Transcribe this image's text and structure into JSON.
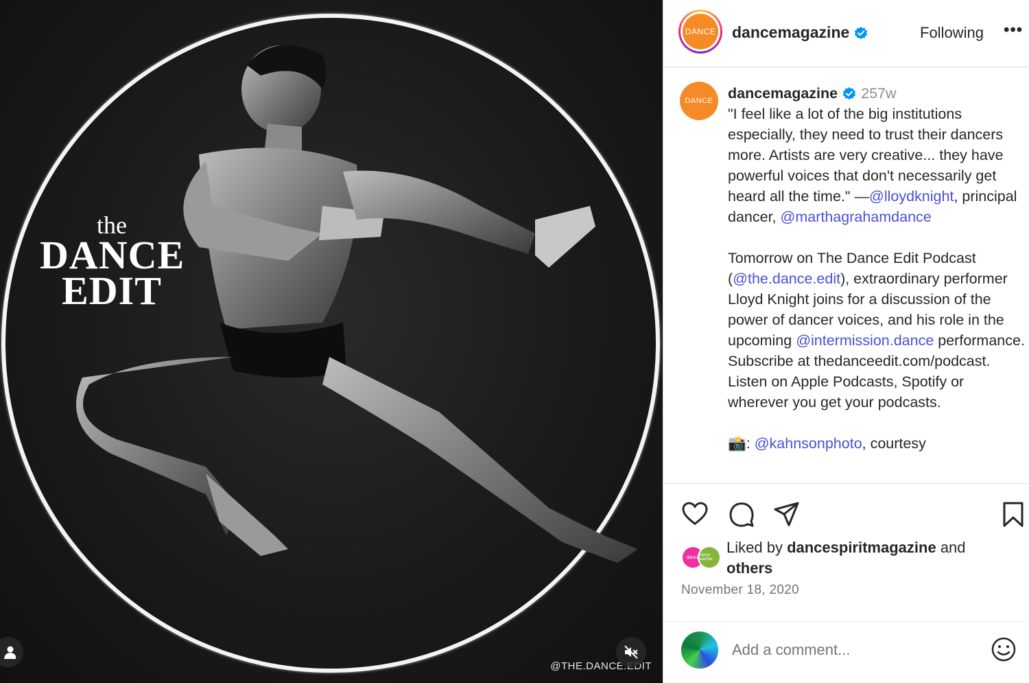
{
  "media": {
    "brand_the": "the",
    "brand_dance": "DANCE",
    "brand_edit": "EDIT",
    "watermark": "@THE.DANCE.EDIT"
  },
  "header": {
    "avatar_text": "DANCE",
    "username": "dancemagazine",
    "following_label": "Following",
    "more_label": "•••"
  },
  "caption": {
    "avatar_text": "DANCE",
    "username": "dancemagazine",
    "age": "257w",
    "quote": "\"I feel like a lot of the big institutions especially, they need to trust their dancers more. Artists are very creative... they have powerful voices that don't necessarily get heard all the time.\"",
    "dash": "—",
    "mention_1": "@lloydknight",
    "role_text": ", principal dancer,",
    "mention_2": "@marthagrahamdance",
    "para2_a": "Tomorrow on The Dance Edit Podcast (",
    "mention_3": "@the.dance.edit",
    "para2_b": "), extraordinary performer Lloyd Knight joins for a discussion of the power of dancer voices, and his role in the upcoming ",
    "mention_4": "@intermission.dance",
    "para2_c": " performance. Subscribe at thedanceedit.com/podcast. Listen on Apple Podcasts, Spotify or wherever you get your podcasts.",
    "cutoff_emoji": "📸",
    "cutoff_mention": "@kahnsonphoto",
    "cutoff_text": ", courtesy"
  },
  "actions": {
    "liked_prefix": "Liked by ",
    "liked_user": "dancespiritmagazine",
    "liked_mid": " and",
    "liked_others": "others",
    "mini_av_1": "dance",
    "mini_av_2": "dance teacher",
    "date": "November 18, 2020",
    "comment_placeholder": "Add a comment..."
  },
  "colors": {
    "accent_link": "#4a50d8",
    "verified_blue": "#0095f6",
    "brand_orange": "#f58a26"
  }
}
